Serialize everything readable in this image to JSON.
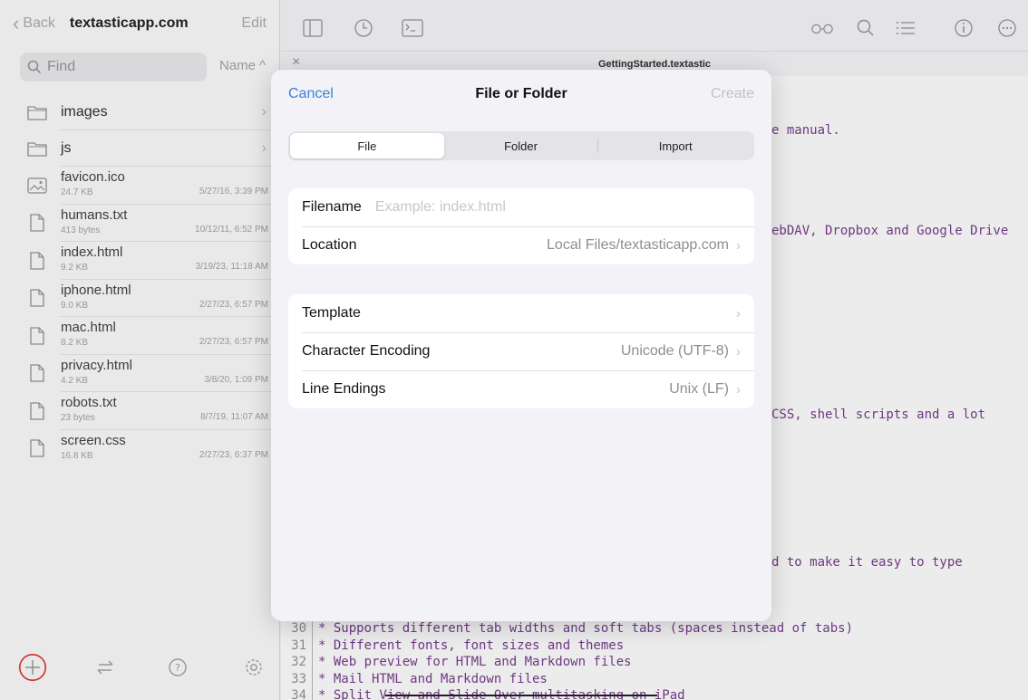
{
  "sidebar": {
    "back_label": "Back",
    "title": "textasticapp.com",
    "edit_label": "Edit",
    "search_placeholder": "Find",
    "sort_label": "Name ^",
    "items": [
      {
        "name": "images",
        "type": "folder"
      },
      {
        "name": "js",
        "type": "folder"
      },
      {
        "name": "favicon.ico",
        "type": "image",
        "size": "24.7 KB",
        "date": "5/27/16, 3:39 PM"
      },
      {
        "name": "humans.txt",
        "type": "file",
        "size": "413 bytes",
        "date": "10/12/11, 6:52 PM"
      },
      {
        "name": "index.html",
        "type": "file",
        "size": "9.2 KB",
        "date": "3/19/23, 11:18 AM"
      },
      {
        "name": "iphone.html",
        "type": "file",
        "size": "9.0 KB",
        "date": "2/27/23, 6:57 PM"
      },
      {
        "name": "mac.html",
        "type": "file",
        "size": "8.2 KB",
        "date": "2/27/23, 6:57 PM"
      },
      {
        "name": "privacy.html",
        "type": "file",
        "size": "4.2 KB",
        "date": "3/8/20, 1:09 PM"
      },
      {
        "name": "robots.txt",
        "type": "file",
        "size": "23 bytes",
        "date": "8/7/19, 11:07 AM"
      },
      {
        "name": "screen.css",
        "type": "file",
        "size": "16.8 KB",
        "date": "2/27/23, 6:37 PM"
      }
    ],
    "highlight_color": "#e02020"
  },
  "editor": {
    "tab_title": "GettingStarted.textastic",
    "fragments": [
      "e manual.",
      "ebDAV, Dropbox and Google Drive",
      "CSS, shell scripts and a lot",
      "d to make it easy to type"
    ],
    "lines": [
      {
        "num": "30",
        "text": "* Supports different tab widths and soft tabs (spaces instead of tabs)"
      },
      {
        "num": "31",
        "text": "* Different fonts, font sizes and themes"
      },
      {
        "num": "32",
        "text": "* Web preview for HTML and Markdown files"
      },
      {
        "num": "33",
        "text": "* Mail HTML and Markdown files"
      },
      {
        "num": "34",
        "text": "* Split View and Slide Over multitasking on iPad"
      }
    ]
  },
  "modal": {
    "cancel_label": "Cancel",
    "title": "File or Folder",
    "create_label": "Create",
    "segments": [
      "File",
      "Folder",
      "Import"
    ],
    "active_segment": "File",
    "filename_label": "Filename",
    "filename_placeholder": "Example: index.html",
    "location_label": "Location",
    "location_value": "Local Files/textasticapp.com",
    "template_label": "Template",
    "encoding_label": "Character Encoding",
    "encoding_value": "Unicode (UTF-8)",
    "line_endings_label": "Line Endings",
    "line_endings_value": "Unix (LF)",
    "accent_color": "#3a82d8"
  }
}
